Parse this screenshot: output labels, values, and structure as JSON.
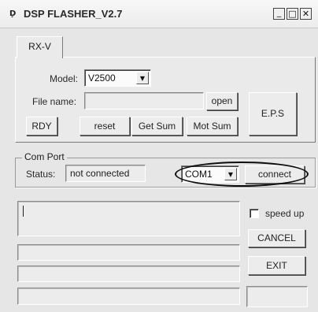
{
  "window": {
    "title": "DSP FLASHER_V2.7",
    "icon_text": "Ḑ",
    "minimize_glyph": "_",
    "maximize_glyph": "□",
    "close_glyph": "✕"
  },
  "tabs": [
    {
      "label": "RX-V",
      "selected": true
    }
  ],
  "rxv": {
    "model_label": "Model:",
    "model_value": "V2500",
    "file_name_label": "File name:",
    "file_name_value": "",
    "open_label": "open",
    "eps_label": "E.P.S",
    "rdy_label": "RDY",
    "reset_label": "reset",
    "get_sum_label": "Get Sum",
    "mot_sum_label": "Mot Sum"
  },
  "com_port": {
    "group_label": "Com Port",
    "status_label": "Status:",
    "status_value": "not connected",
    "port_value": "COM1",
    "connect_label": "connect"
  },
  "side": {
    "speed_up_label": "speed up",
    "speed_up_checked": false,
    "cancel_label": "CANCEL",
    "exit_label": "EXIT"
  },
  "icons": {
    "dropdown_arrow": "▼"
  }
}
